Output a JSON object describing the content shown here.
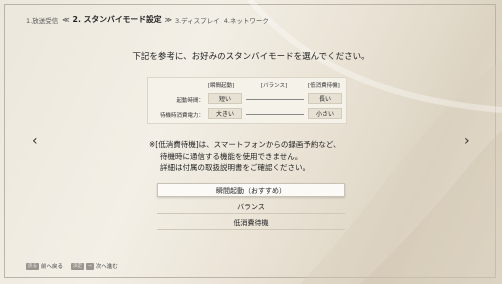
{
  "steps": {
    "step1": "1.放送受信",
    "prev_arrow": "≪",
    "step2": "2. スタンバイモード設定",
    "next_arrow": "≫",
    "step3": "3.ディスプレイ",
    "step4": "4.ネットワーク"
  },
  "prompt": "下記を参考に、お好みのスタンバイモードを選んでください。",
  "comparison": {
    "headers": [
      "[瞬間起動]",
      "[バランス]",
      "[低消費待機]"
    ],
    "rows": [
      {
        "label": "起動時間：",
        "left": "短い",
        "right": "長い"
      },
      {
        "label": "待機時消費電力：",
        "left": "大きい",
        "right": "小さい"
      }
    ]
  },
  "note": {
    "line1": "※[低消費待機]は、スマートフォンからの録画予約など、",
    "line2": "待機時に通信する機能を使用できません。",
    "line3": "詳細は付属の取扱説明書をご確認ください。"
  },
  "options": [
    "瞬間起動（おすすめ）",
    "バランス",
    "低消費待機"
  ],
  "selected_option_index": 0,
  "nav": {
    "left": "‹",
    "right": "›"
  },
  "footer": {
    "back_key": "戻る",
    "back_label": "前へ戻る",
    "next_key1": "決定",
    "next_key2": "→",
    "next_label": "次へ進む"
  }
}
